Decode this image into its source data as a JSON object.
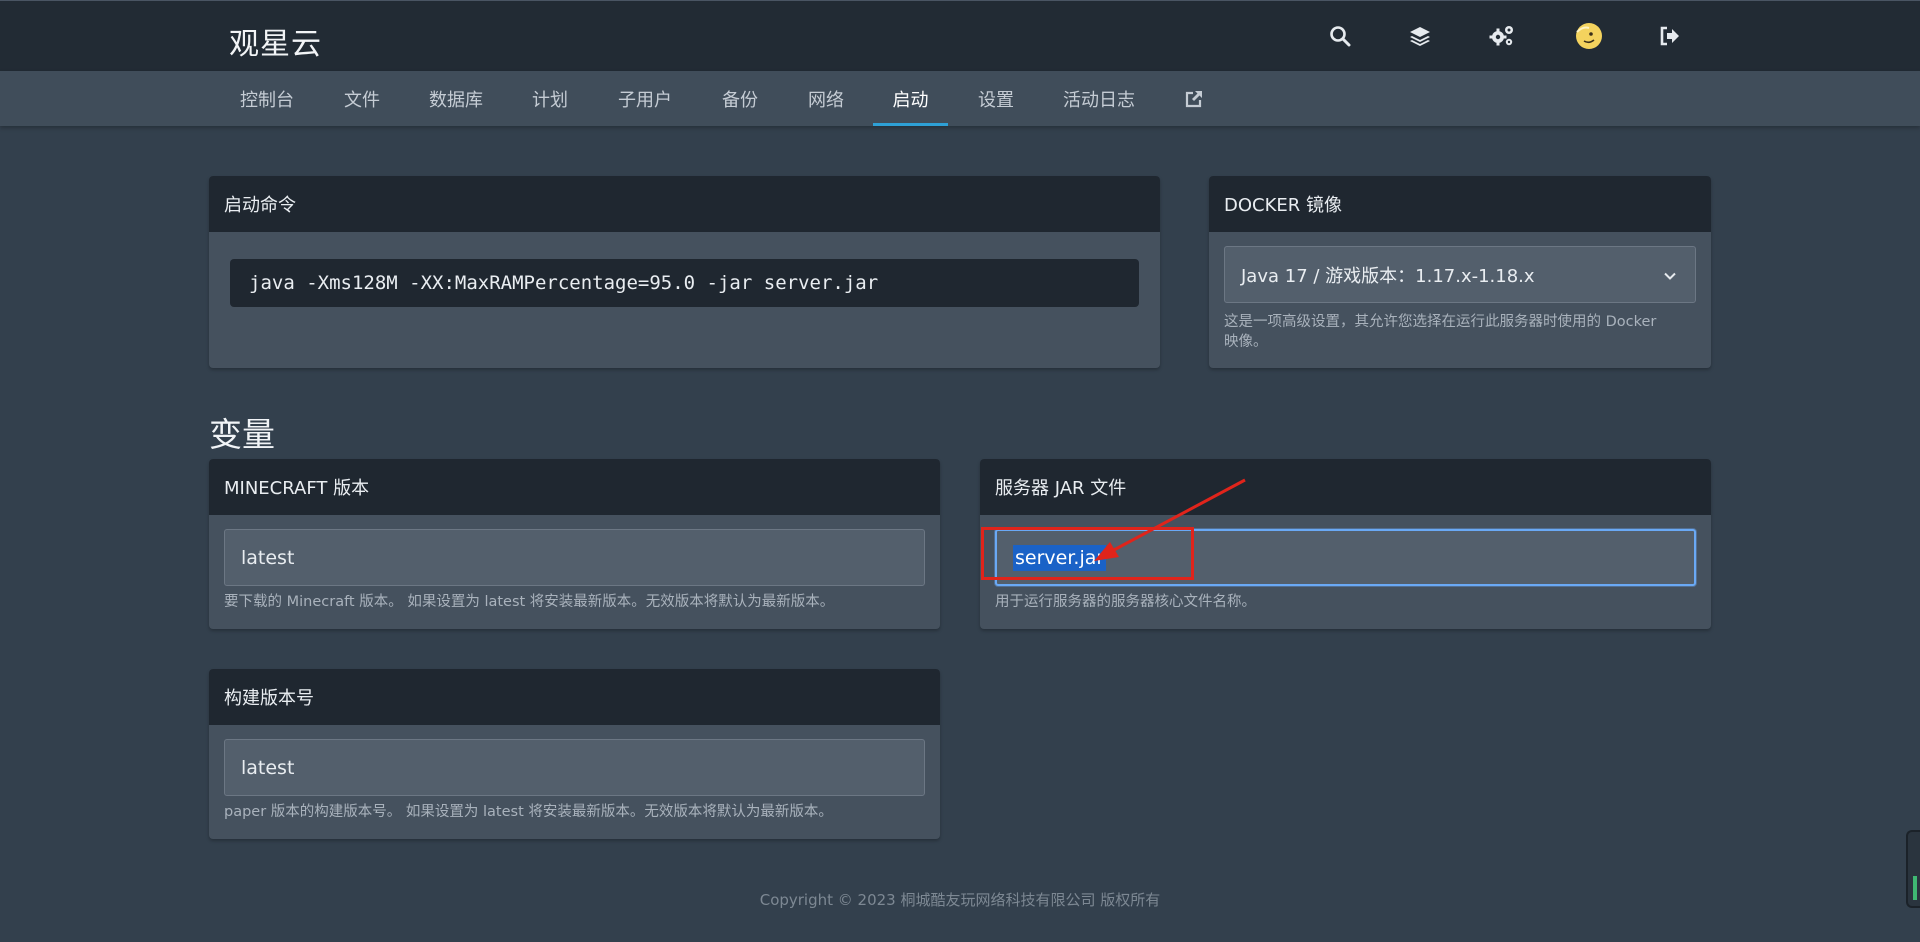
{
  "app": {
    "brand": "观星云"
  },
  "top_icons": [
    "search-icon",
    "layers-icon",
    "cogs-icon",
    "avatar",
    "sign-out-icon"
  ],
  "nav": {
    "items": [
      "控制台",
      "文件",
      "数据库",
      "计划",
      "子用户",
      "备份",
      "网络",
      "启动",
      "设置",
      "活动日志"
    ],
    "active": "启动",
    "external_icon": "external-link-icon"
  },
  "startup": {
    "title": "启动命令",
    "command": "java -Xms128M -XX:MaxRAMPercentage=95.0 -jar server.jar"
  },
  "docker": {
    "title": "DOCKER 镜像",
    "selected": "Java 17 / 游戏版本：1.17.x-1.18.x",
    "help_line1": "这是一项高级设置，其允许您选择在运行此服务器时使用的 Docker",
    "help_line2": "映像。"
  },
  "variables": {
    "title": "变量",
    "minecraft_version": {
      "title": "MINECRAFT 版本",
      "value": "latest",
      "help": "要下载的 Minecraft 版本。 如果设置为 latest 将安装最新版本。无效版本将默认为最新版本。"
    },
    "server_jar": {
      "title": "服务器 JAR 文件",
      "value": "server.jar",
      "help": "用于运行服务器的服务器核心文件名称。"
    },
    "build_number": {
      "title": "构建版本号",
      "value": "latest",
      "help": "paper 版本的构建版本号。 如果设置为 latest 将安装最新版本。无效版本将默认为最新版本。"
    }
  },
  "footer": {
    "text": "Copyright © 2023 桐城酷友玩网络科技有限公司 版权所有"
  },
  "colors": {
    "topbar": "#222b34",
    "navbar": "#404d5a",
    "page": "#33404d",
    "card": "#45515e",
    "card_header": "#1f2730",
    "accent": "#2ea0d6",
    "annotation": "#e0241b",
    "focus": "#6aa9f5"
  }
}
